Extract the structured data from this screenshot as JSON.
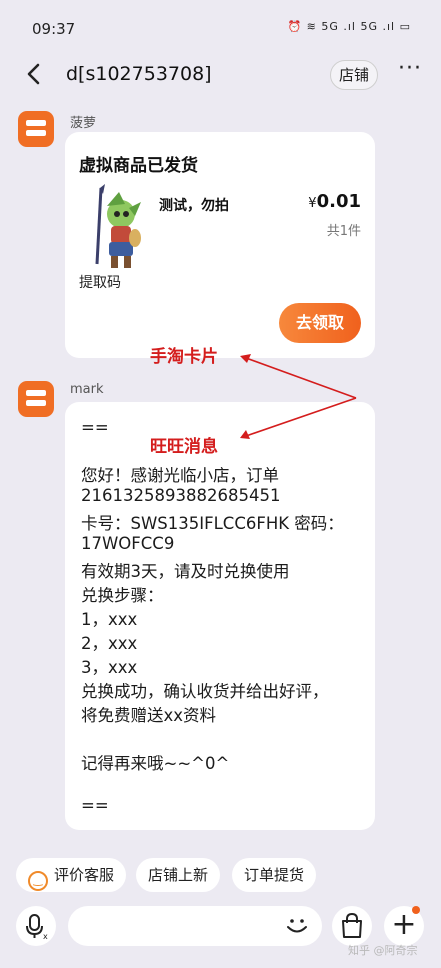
{
  "status_bar": {
    "time": "09:37",
    "icons": "⏰ ≋ 5G .ıl 5G .ıl ▭"
  },
  "header": {
    "title": "d[s102753708]",
    "shop_button": "店铺",
    "more": "···"
  },
  "messages": [
    {
      "sender": "菠萝",
      "card": {
        "title": "虚拟商品已发货",
        "product_name": "测试，勿拍",
        "price_symbol": "¥",
        "price": "0.01",
        "quantity": "共1件",
        "code_label": "提取码",
        "claim_button": "去领取"
      }
    },
    {
      "sender": "mark",
      "lines": [
        "==",
        "",
        "您好！感谢光临小店，订单",
        "2161325893882685451",
        "卡号：SWS135IFLCC6FHK 密码：",
        "17WOFCC9",
        "有效期3天，请及时兑换使用",
        "兑换步骤：",
        "1，xxx",
        "2，xxx",
        "3，xxx",
        "兑换成功，确认收货并给出好评，",
        "将免费赠送xx资料",
        "",
        "记得再来哦~~^0^",
        "",
        "=="
      ]
    }
  ],
  "annotations": {
    "card": "手淘卡片",
    "wangwang": "旺旺消息",
    "color": "#d41d1d"
  },
  "quick_actions": [
    "评价客服",
    "店铺上新",
    "订单提货"
  ],
  "bottom": {
    "plus": "+"
  },
  "watermark": "知乎 @阿奇宗",
  "colors": {
    "accent": "#f0611d",
    "avatar": "#f06e24",
    "background": "#eceaf2"
  }
}
